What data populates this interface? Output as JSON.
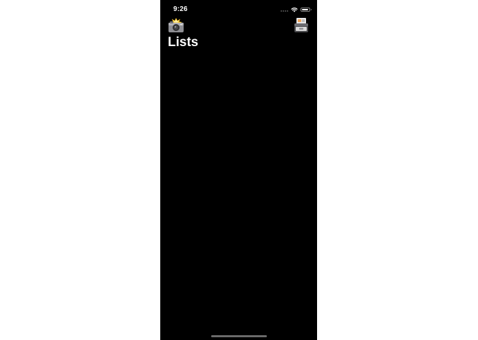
{
  "status_bar": {
    "time": "9:26",
    "icons": [
      "cellular-signal-icon",
      "wifi-icon",
      "battery-icon"
    ],
    "battery_level": 0.85
  },
  "nav_bar": {
    "left_button_icon": "camera-flash-icon",
    "right_button_icon": "card-box-icon"
  },
  "main": {
    "title": "Lists"
  },
  "colors": {
    "background": "#000000",
    "text": "#ffffff",
    "outer_background": "#ffffff"
  }
}
